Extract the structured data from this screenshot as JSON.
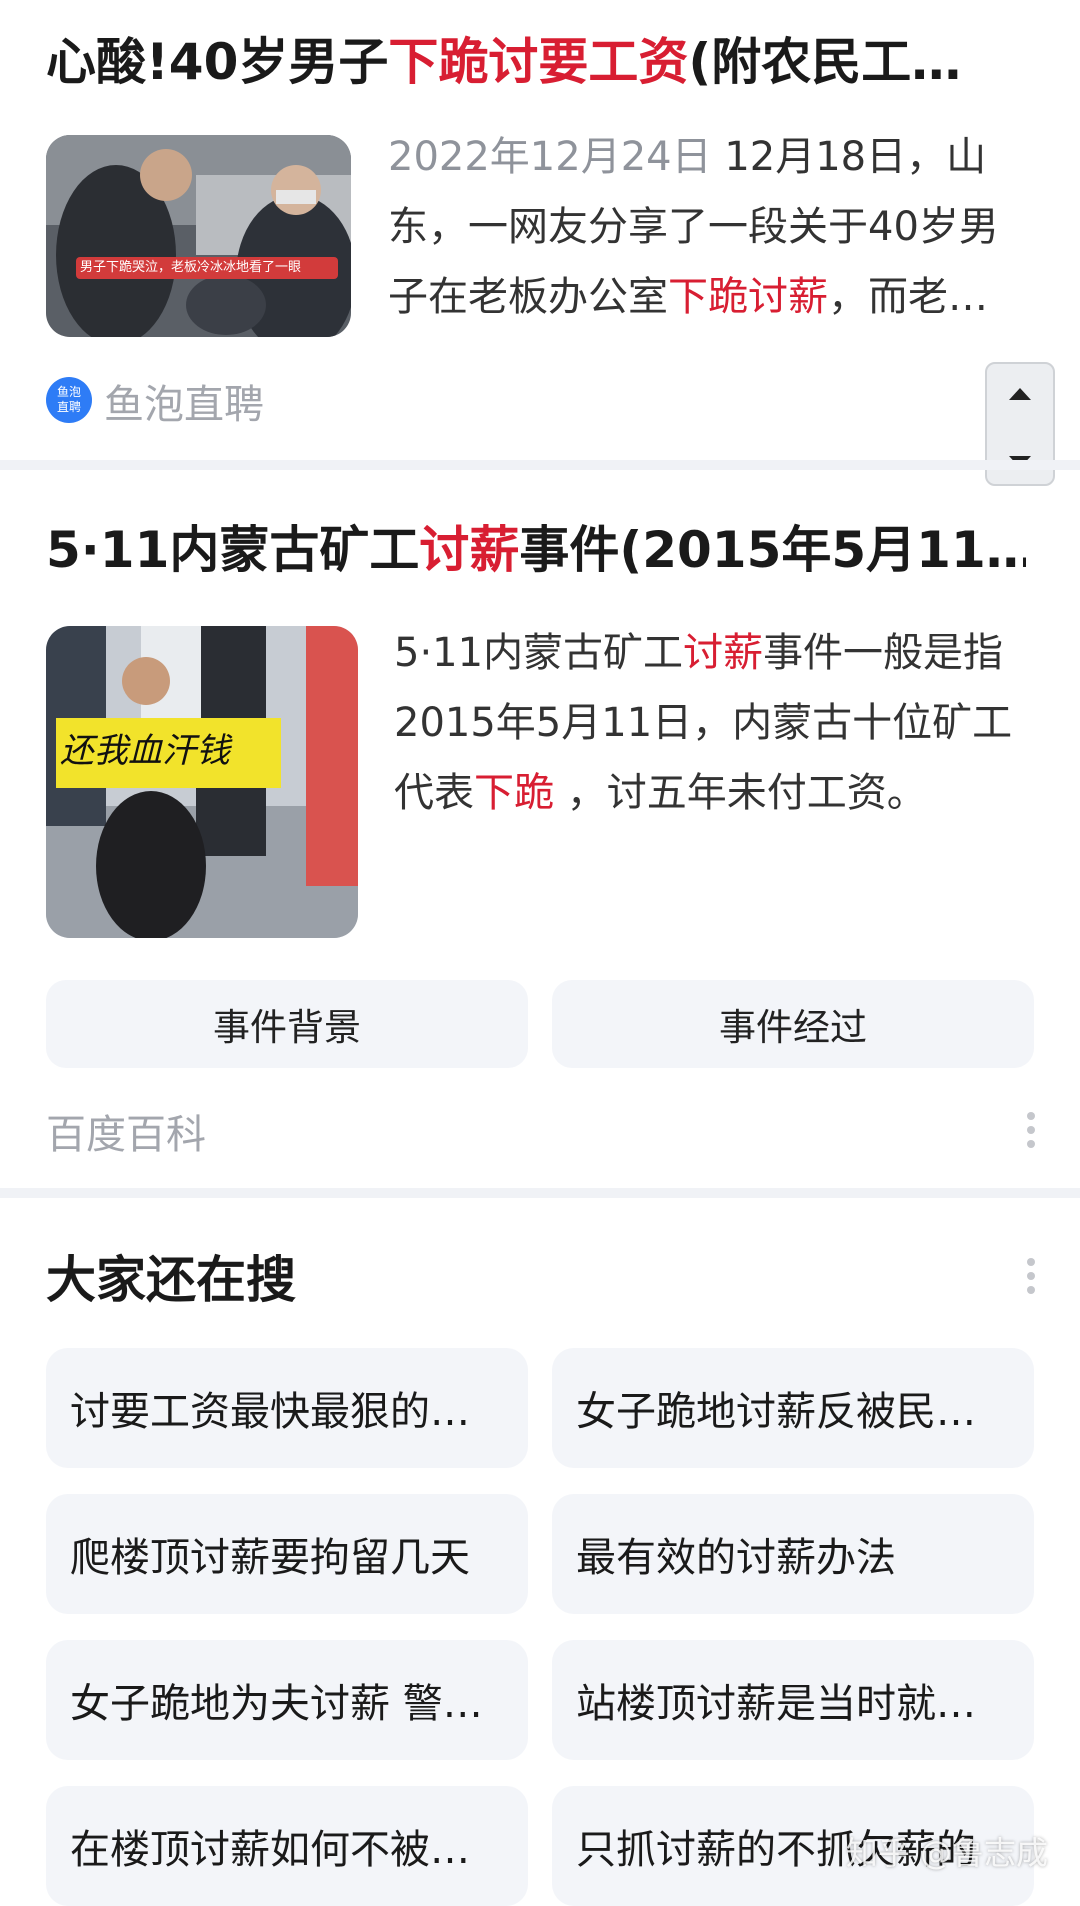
{
  "result1": {
    "title_pre": "心酸!40岁男子",
    "title_hl": "下跪讨要工资",
    "title_post": "(附农民工…",
    "date": "2022年12月24日",
    "snippet_pre": "12月18日，山东，一网友分享了一段关于40岁男子在老板办公室",
    "snippet_hl": "下跪讨薪",
    "snippet_post": "，而老…",
    "thumb_caption": "男子下跪哭泣，老板冷冰冰地看了一眼",
    "source_icon_line1": "鱼泡",
    "source_icon_line2": "直聘",
    "source": "鱼泡直聘"
  },
  "result2": {
    "title_pre": "5·11内蒙古矿工",
    "title_hl": "讨薪",
    "title_post": "事件(2015年5月11…",
    "snippet_a": "5·11内蒙古矿工",
    "snippet_hl1": "讨薪",
    "snippet_b": "事件一般是指2015年5月11日，内蒙古十位矿工代表",
    "snippet_hl2": "下跪",
    "snippet_c": " ，讨五年未付工资。",
    "sign_text": "还我血汗钱",
    "button_background": "事件背景",
    "button_process": "事件经过",
    "source": "百度百科"
  },
  "related": {
    "heading": "大家还在搜",
    "items": [
      "讨要工资最快最狠的…",
      "女子跪地讨薪反被民…",
      "爬楼顶讨薪要拘留几天",
      "最有效的讨薪办法",
      "女子跪地为夫讨薪 警…",
      "站楼顶讨薪是当时就…",
      "在楼顶讨薪如何不被…",
      "只抓讨薪的不抓欠薪的"
    ]
  },
  "watermark": "知乎 @鲁志成",
  "colors": {
    "highlight": "#d81e32",
    "pill_bg": "#f3f5f9",
    "divider": "#f0f2f6"
  }
}
